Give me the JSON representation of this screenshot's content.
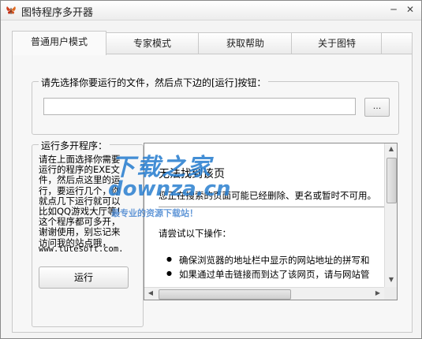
{
  "window": {
    "title": "图特程序多开器",
    "minimize_glyph": "─",
    "close_glyph": "✕"
  },
  "tabs": [
    {
      "label": "普通用户模式",
      "active": true
    },
    {
      "label": "专家模式",
      "active": false
    },
    {
      "label": "获取帮助",
      "active": false
    },
    {
      "label": "关于图特",
      "active": false
    }
  ],
  "file_group": {
    "label": "请先选择你要运行的文件，然后点下边的[运行]按钮：",
    "input_value": "",
    "browse_label": "..."
  },
  "run_group": {
    "label": "运行多开程序：",
    "info_text": "请在上面选择你需要\n运行的程序的EXE文\n件，然后点这里的运\n行，要运行几个，你\n就点几下运行就可以\n比如QQ游戏大厅等！\n这个程序都可多开，\n谢谢使用，别忘记来\n访问我的站点哦，",
    "site_url": "www.tutesoft.com.",
    "run_button": "运行"
  },
  "browser": {
    "error_title": "无法找到该页",
    "error_desc": "您正在搜索的页面可能已经删除、更名或暂时不可用。",
    "try_label": "请尝试以下操作：",
    "tips": [
      "确保浏览器的地址栏中显示的网站地址的拼写和",
      "如果通过单击链接而到达了该网页，请与网站管"
    ]
  },
  "watermark": {
    "line1": "下载之家",
    "line2": "downza.cn",
    "line3": "最专业的资源下载站！",
    "color": "#2a7fd0"
  },
  "colors": {
    "window_bg": "#f4f4f4",
    "border": "#c9c9c9",
    "accent_blue": "#2a7fd0"
  },
  "icons": {
    "app": "butterfly-icon",
    "scroll_up": "arrow-up-icon",
    "scroll_down": "arrow-down-icon",
    "scroll_left": "arrow-left-icon",
    "scroll_right": "arrow-right-icon"
  }
}
